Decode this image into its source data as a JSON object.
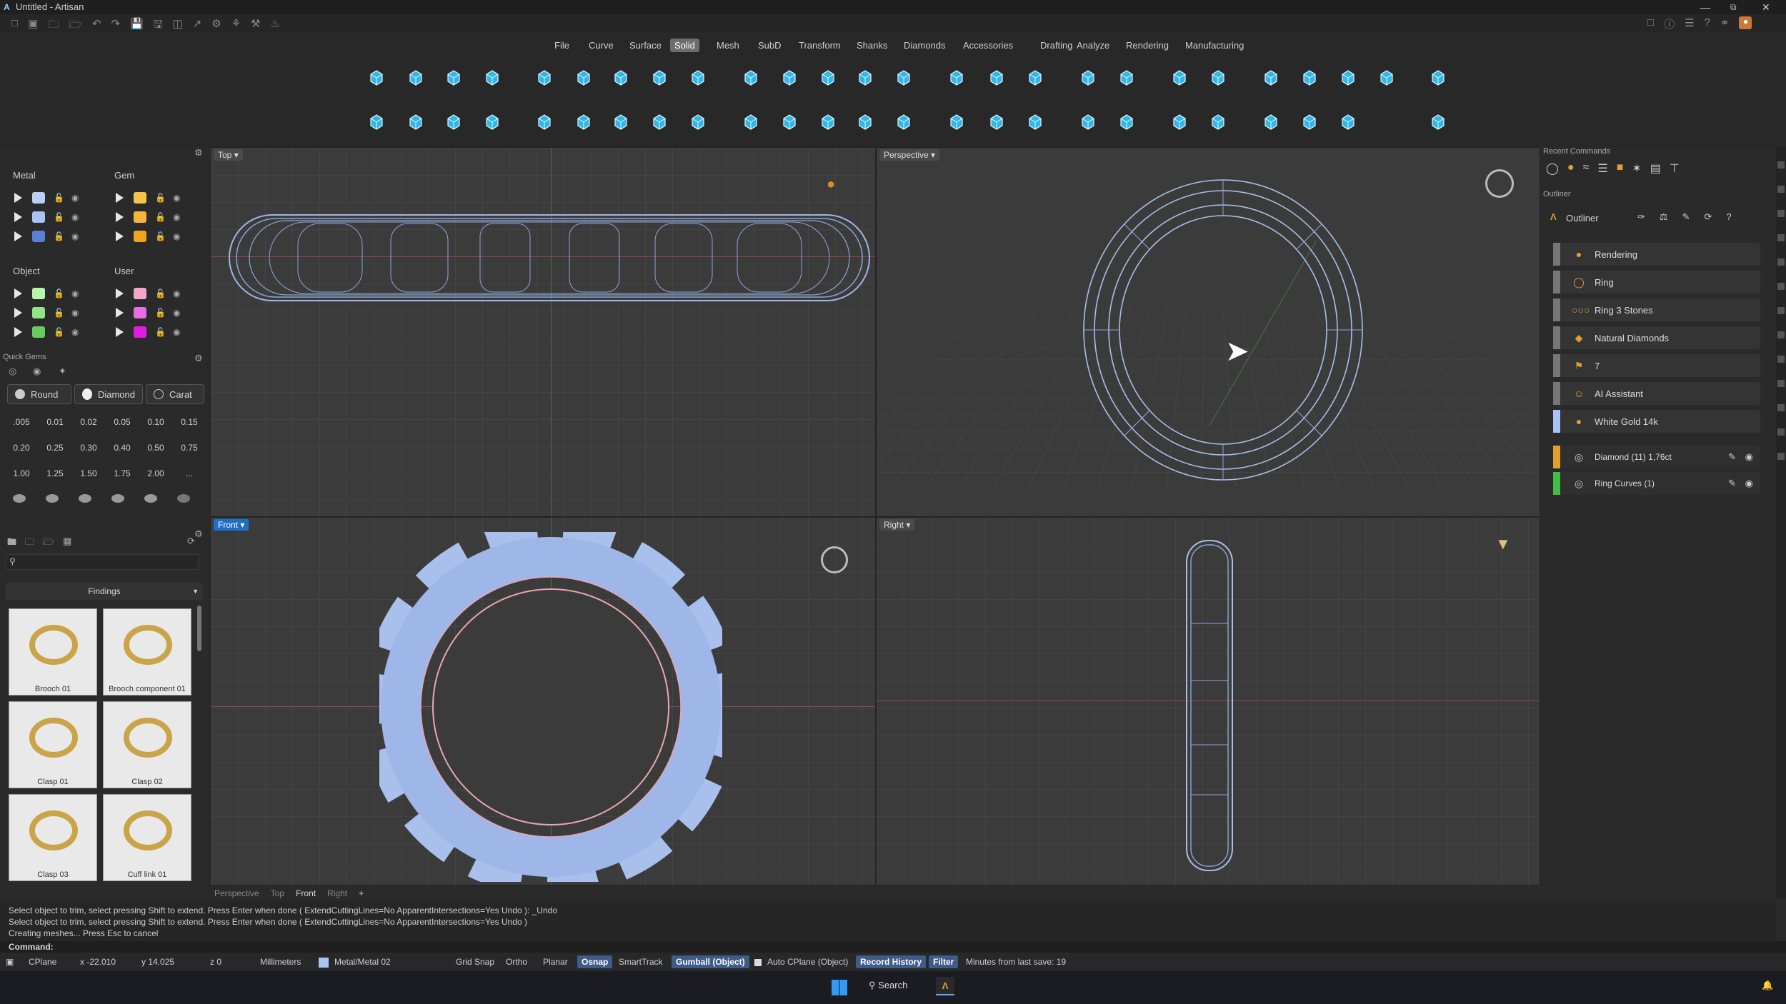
{
  "window": {
    "title": "Untitled - Artisan"
  },
  "menu": {
    "items": [
      "File",
      "Curve",
      "Surface",
      "Solid",
      "Mesh",
      "SubD",
      "Transform",
      "Shanks",
      "Diamonds",
      "Accessories",
      "Drafting",
      "Analyze",
      "Rendering",
      "Manufacturing"
    ],
    "active": "Solid"
  },
  "layers": {
    "metal_title": "Metal",
    "gem_title": "Gem",
    "object_title": "Object",
    "user_title": "User",
    "metal_colors": [
      "#b9cff5",
      "#a9c3f3",
      "#5a7fd6"
    ],
    "gem_colors": [
      "#f7c34d",
      "#f5b53a",
      "#eea321"
    ],
    "object_colors": [
      "#b9f5a9",
      "#8fe882",
      "#66cc60"
    ],
    "user_colors": [
      "#f5a6c8",
      "#e56ee0",
      "#e21be2"
    ]
  },
  "quick_gems": {
    "title": "Quick Gems",
    "shape": "Round",
    "cut": "Diamond",
    "unit": "Carat",
    "values": [
      ".005",
      "0.01",
      "0.02",
      "0.05",
      "0.10",
      "0.15",
      "0.20",
      "0.25",
      "0.30",
      "0.40",
      "0.50",
      "0.75",
      "1.00",
      "1.25",
      "1.50",
      "1.75",
      "2.00",
      "..."
    ]
  },
  "library": {
    "category": "Findings",
    "items": [
      "Brooch 01",
      "Brooch component 01",
      "Clasp 01",
      "Clasp 02",
      "Clasp 03",
      "Cuff link 01"
    ]
  },
  "viewports": {
    "top": "Top",
    "perspective": "Perspective",
    "front": "Front",
    "right": "Right"
  },
  "viewport_tabs": [
    "Perspective",
    "Top",
    "Front",
    "Right"
  ],
  "recent_commands": {
    "title": "Recent Commands"
  },
  "outliner": {
    "title": "Outliner",
    "header": "Outliner",
    "rows": [
      "Rendering",
      "Ring",
      "Ring 3 Stones",
      "Natural Diamonds",
      "7",
      "AI Assistant",
      "White Gold 14k"
    ],
    "objects": [
      "Diamond (11) 1,76ct",
      "Ring Curves (1)"
    ]
  },
  "command_history": [
    "Select object to trim, select pressing Shift to extend. Press Enter when done ( ExtendCuttingLines=No  ApparentIntersections=Yes  Undo ): _Undo",
    "Select object to trim, select pressing Shift to extend. Press Enter when done ( ExtendCuttingLines=No  ApparentIntersections=Yes  Undo )",
    "Creating meshes... Press Esc to cancel"
  ],
  "command_prompt": "Command:",
  "status": {
    "cplane": "CPlane",
    "x": "x -22.010",
    "y": "y 14.025",
    "z": "z 0",
    "units": "Millimeters",
    "layer": "Metal/Metal 02",
    "grid_snap": "Grid Snap",
    "ortho": "Ortho",
    "planar": "Planar",
    "osnap": "Osnap",
    "smarttrack": "SmartTrack",
    "gumball": "Gumball (Object)",
    "auto_cplane": "Auto CPlane (Object)",
    "record_history": "Record History",
    "filter": "Filter",
    "last_save": "Minutes from last save: 19"
  },
  "taskbar": {
    "search": "Search"
  }
}
